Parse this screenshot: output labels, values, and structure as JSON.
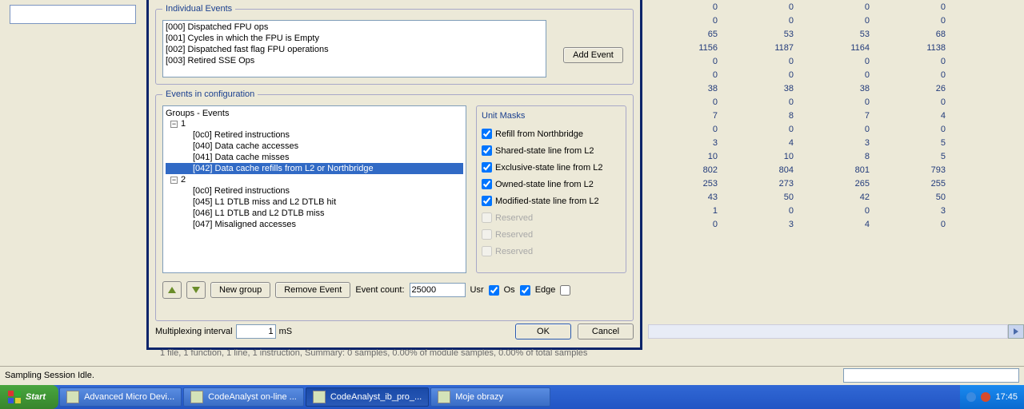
{
  "individual_events": {
    "legend": "Individual Events",
    "items": [
      "[000] Dispatched FPU ops",
      "[001] Cycles in which the FPU is Empty",
      "[002] Dispatched fast flag FPU operations",
      "[003] Retired SSE Ops"
    ],
    "add_btn": "Add Event"
  },
  "config": {
    "legend": "Events in configuration",
    "tree_header": "Groups - Events",
    "group1": {
      "label": "1",
      "items": [
        "[0c0] Retired instructions",
        "[040] Data cache accesses",
        "[041] Data cache misses",
        "[042] Data cache refills from L2 or Northbridge"
      ],
      "selected_index": 3
    },
    "group2": {
      "label": "2",
      "items": [
        "[0c0] Retired instructions",
        "[045] L1 DTLB miss and L2 DTLB hit",
        "[046] L1 DTLB and L2 DTLB miss",
        "[047] Misaligned accesses"
      ]
    },
    "masks": {
      "title": "Unit Masks",
      "items": [
        {
          "label": "Refill from Northbridge",
          "checked": true,
          "enabled": true
        },
        {
          "label": "Shared-state line from L2",
          "checked": true,
          "enabled": true
        },
        {
          "label": "Exclusive-state line from L2",
          "checked": true,
          "enabled": true
        },
        {
          "label": "Owned-state line from L2",
          "checked": true,
          "enabled": true
        },
        {
          "label": "Modified-state line from L2",
          "checked": true,
          "enabled": true
        },
        {
          "label": "Reserved",
          "checked": false,
          "enabled": false
        },
        {
          "label": "Reserved",
          "checked": false,
          "enabled": false
        },
        {
          "label": "Reserved",
          "checked": false,
          "enabled": false
        }
      ]
    },
    "new_group_btn": "New group",
    "remove_btn": "Remove Event",
    "event_count_label": "Event count:",
    "event_count_value": "25000",
    "usr_label": "Usr",
    "usr_checked": true,
    "os_label": "Os",
    "os_checked": true,
    "edge_label": "Edge",
    "edge_checked": false
  },
  "footer": {
    "mux_label": "Multiplexing interval",
    "mux_value": "1",
    "mux_unit": "mS",
    "ok": "OK",
    "cancel": "Cancel"
  },
  "grid": {
    "rows": [
      [
        0,
        0,
        0,
        0
      ],
      [
        0,
        0,
        0,
        0
      ],
      [
        65,
        53,
        53,
        68
      ],
      [
        1156,
        1187,
        1164,
        1138
      ],
      [
        0,
        0,
        0,
        0
      ],
      [
        0,
        0,
        0,
        0
      ],
      [
        38,
        38,
        38,
        26
      ],
      [
        0,
        0,
        0,
        0
      ],
      [
        7,
        8,
        7,
        4
      ],
      [
        0,
        0,
        0,
        0
      ],
      [
        3,
        4,
        3,
        5
      ],
      [
        10,
        10,
        8,
        5
      ],
      [
        802,
        804,
        801,
        793
      ],
      [
        253,
        273,
        265,
        255
      ],
      [
        43,
        50,
        42,
        50
      ],
      [
        1,
        0,
        0,
        3
      ],
      [
        0,
        3,
        4,
        0
      ]
    ]
  },
  "summary": "1 file, 1 function, 1 line, 1 instruction, Summary: 0 samples, 0.00% of module samples, 0.00% of total samples",
  "status": "Sampling Session Idle.",
  "taskbar": {
    "start": "Start",
    "items": [
      "Advanced Micro Devi...",
      "CodeAnalyst on-line ...",
      "CodeAnalyst_ib_pro_...",
      "Moje obrazy"
    ],
    "clock": "17:45"
  }
}
